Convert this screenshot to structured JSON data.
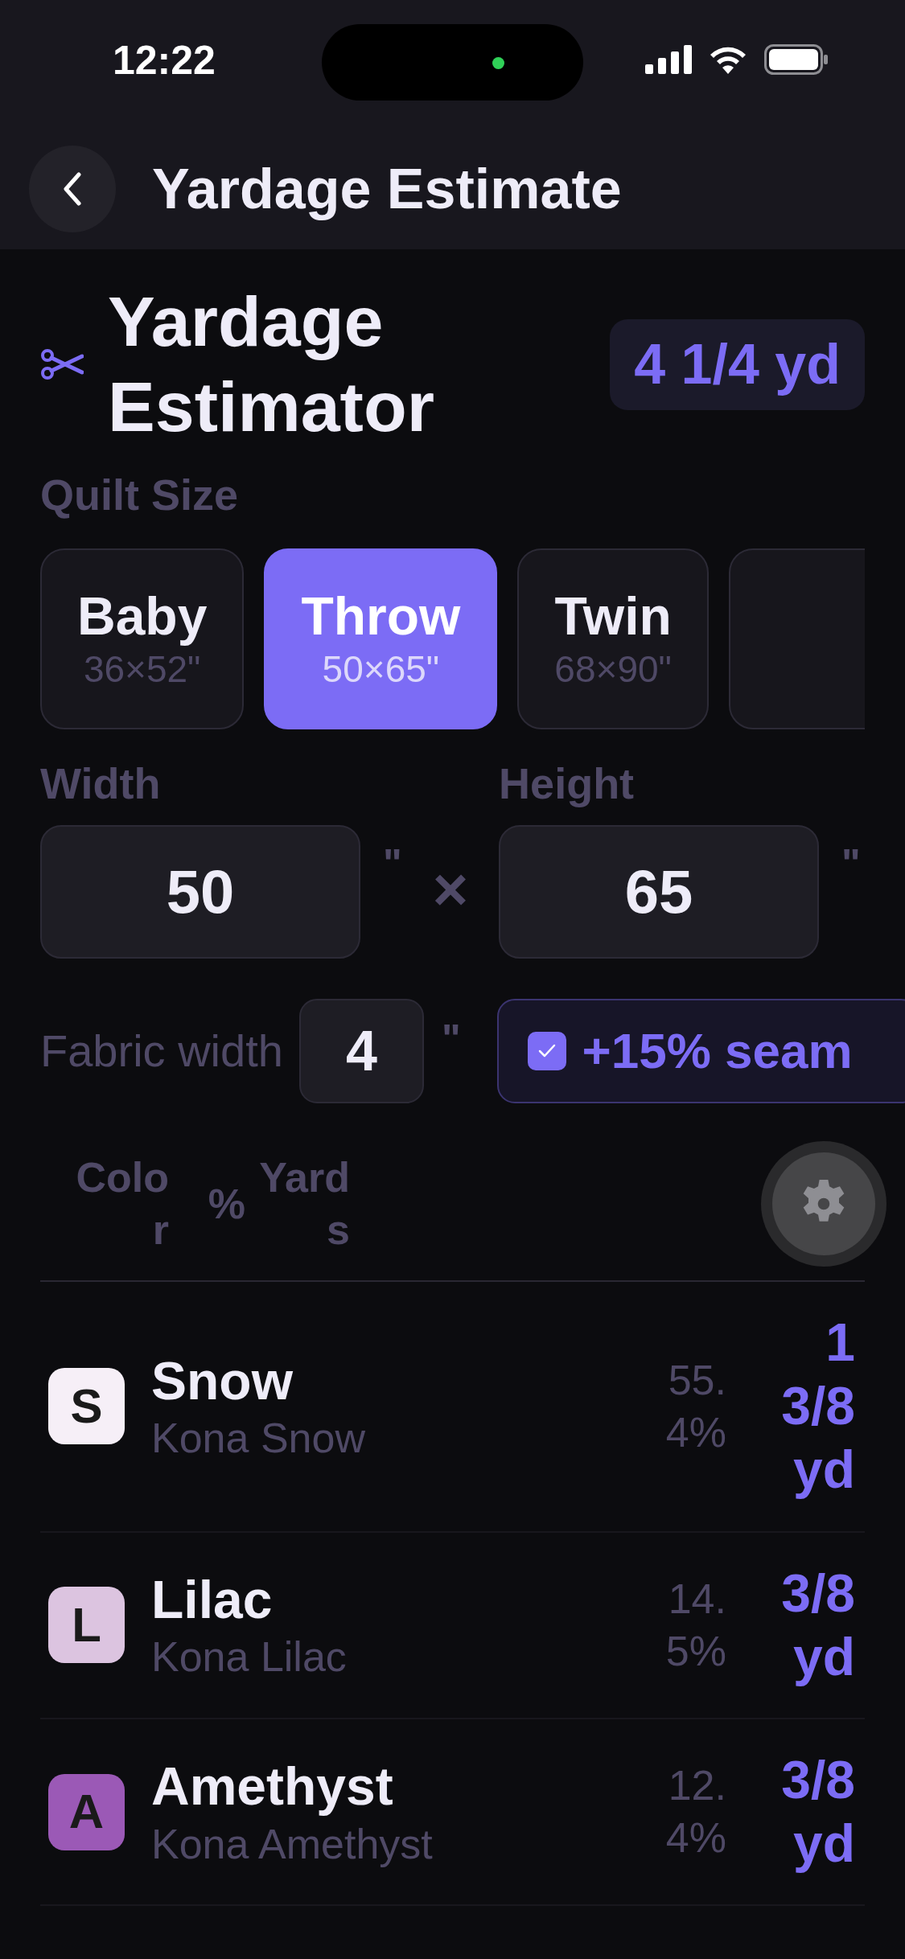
{
  "status_bar": {
    "time": "12:22"
  },
  "nav": {
    "title": "Yardage Estimate"
  },
  "header": {
    "title": "Yardage Estimator",
    "total": "4 1/4 yd"
  },
  "quilt_size": {
    "label": "Quilt Size",
    "options": [
      {
        "name": "Baby",
        "dims": "36×52\"",
        "selected": false
      },
      {
        "name": "Throw",
        "dims": "50×65\"",
        "selected": true
      },
      {
        "name": "Twin",
        "dims": "68×90\"",
        "selected": false
      },
      {
        "selected": false
      }
    ]
  },
  "dimensions": {
    "width": {
      "label": "Width",
      "value": "50",
      "unit": "\""
    },
    "times": "×",
    "height": {
      "label": "Height",
      "value": "65",
      "unit": "\""
    }
  },
  "fabric_width": {
    "label": "Fabric width",
    "value": "4",
    "unit": "\""
  },
  "seam_allowance": {
    "label": "+15% seam",
    "checked": true
  },
  "table": {
    "columns": [
      "Color",
      "%",
      "Yards"
    ],
    "rows": [
      {
        "letter": "S",
        "name": "Snow",
        "fabric": "Kona Snow",
        "percent": "55.4%",
        "yards": "1 3/8 yd",
        "color": "#f6eff7"
      },
      {
        "letter": "L",
        "name": "Lilac",
        "fabric": "Kona Lilac",
        "percent": "14.5%",
        "yards": "3/8 yd",
        "color": "#dcc4e0"
      },
      {
        "letter": "A",
        "name": "Amethyst",
        "fabric": "Kona Amethyst",
        "percent": "12.4%",
        "yards": "3/8 yd",
        "color": "#9b59b6"
      }
    ]
  }
}
